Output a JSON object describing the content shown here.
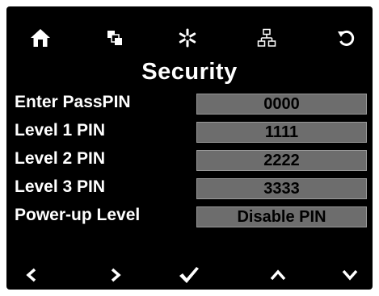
{
  "screen": {
    "title": "Security",
    "background_color": "#000000",
    "field_color": "#6d6d6d"
  },
  "toolbar": {
    "icons": [
      "home-icon",
      "copy-icon",
      "asterisk-icon",
      "network-icon",
      "undo-icon"
    ]
  },
  "rows": [
    {
      "label": "Enter PassPIN",
      "value": "0000"
    },
    {
      "label": "Level 1 PIN",
      "value": "1111"
    },
    {
      "label": "Level 2 PIN",
      "value": "2222"
    },
    {
      "label": "Level 3 PIN",
      "value": "3333"
    },
    {
      "label": "Power-up Level",
      "value": "Disable PIN"
    }
  ],
  "bottom_bar": {
    "icons": [
      "chevron-left-icon",
      "chevron-right-icon",
      "checkmark-icon",
      "chevron-up-icon",
      "chevron-down-icon"
    ]
  }
}
